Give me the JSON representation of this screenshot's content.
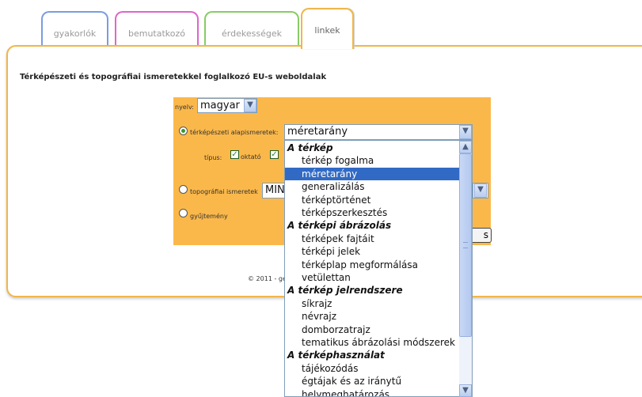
{
  "tabs": [
    {
      "label": "gyakorlók"
    },
    {
      "label": "bemutatkozó"
    },
    {
      "label": "érdekességek"
    },
    {
      "label": "linkek"
    }
  ],
  "page": {
    "heading": "Térképészeti és topográfiai ismeretekkel foglalkozó EU-s weboldalak",
    "footer": "© 2011 - ge"
  },
  "form": {
    "language_label": "nyelv:",
    "language_value": "magyar",
    "radio_basics_label": "térképészeti alapismeretek:",
    "radio_basics_value": "méretarány",
    "type_label": "típus:",
    "check1_label": "oktató",
    "radio_topo_label": "topográfiai ismeretek",
    "topo_value": "MIN",
    "radio_collection_label": "gyűjtemény",
    "button_fragment": "s"
  },
  "dropdown": {
    "items": [
      {
        "text": "A térkép",
        "kind": "group"
      },
      {
        "text": "térkép fogalma",
        "kind": "option"
      },
      {
        "text": "méretarány",
        "kind": "option",
        "selected": true
      },
      {
        "text": "generalizálás",
        "kind": "option"
      },
      {
        "text": "térképtörténet",
        "kind": "option"
      },
      {
        "text": "térképszerkesztés",
        "kind": "option"
      },
      {
        "text": "A térképi ábrázolás",
        "kind": "group"
      },
      {
        "text": "térképek fajtáit",
        "kind": "option"
      },
      {
        "text": "térképi jelek",
        "kind": "option"
      },
      {
        "text": "térképlap megformálása",
        "kind": "option"
      },
      {
        "text": "vetülettan",
        "kind": "option"
      },
      {
        "text": "A térkép jelrendszere",
        "kind": "group"
      },
      {
        "text": "síkrajz",
        "kind": "option"
      },
      {
        "text": "névrajz",
        "kind": "option"
      },
      {
        "text": "domborzatrajz",
        "kind": "option"
      },
      {
        "text": "tematikus ábrázolási módszerek",
        "kind": "option"
      },
      {
        "text": "A térképhasználat",
        "kind": "group"
      },
      {
        "text": "tájékozódás",
        "kind": "option"
      },
      {
        "text": "égtájak és az iránytű",
        "kind": "option"
      },
      {
        "text": "helymeghatározás",
        "kind": "option"
      }
    ]
  },
  "icons": {
    "select_arrow": "chevron-down-icon",
    "scroll_up": "chevron-up-icon",
    "scroll_down": "chevron-down-icon"
  },
  "colors": {
    "form_bg": "#fbb84a",
    "accent_border": "#f0b64a",
    "selection": "#316ac5"
  }
}
